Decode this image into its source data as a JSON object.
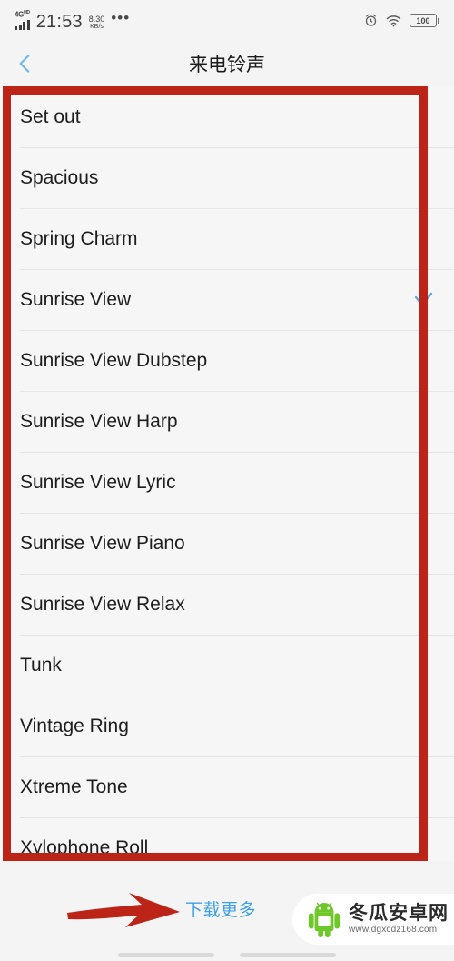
{
  "status_bar": {
    "network_type": "4G",
    "network_suffix": "HD",
    "time": "21:53",
    "net_speed_value": "8.30",
    "net_speed_unit": "KB/s",
    "overflow_dots": "•••",
    "alarm_icon": "alarm-clock-icon",
    "wifi_icon": "wifi-icon",
    "battery_level": "100"
  },
  "title_bar": {
    "back_icon": "chevron-left-icon",
    "title": "来电铃声"
  },
  "ringtone_list": {
    "selected": "Sunrise View",
    "check_icon": "checkmark-icon",
    "items": [
      {
        "label": "Set out",
        "selected": false
      },
      {
        "label": "Spacious",
        "selected": false
      },
      {
        "label": "Spring Charm",
        "selected": false
      },
      {
        "label": "Sunrise View",
        "selected": true
      },
      {
        "label": "Sunrise View Dubstep",
        "selected": false
      },
      {
        "label": "Sunrise View Harp",
        "selected": false
      },
      {
        "label": "Sunrise View Lyric",
        "selected": false
      },
      {
        "label": "Sunrise View Piano",
        "selected": false
      },
      {
        "label": "Sunrise View Relax",
        "selected": false
      },
      {
        "label": "Tunk",
        "selected": false
      },
      {
        "label": "Vintage Ring",
        "selected": false
      },
      {
        "label": "Xtreme Tone",
        "selected": false
      },
      {
        "label": "Xylophone Roll",
        "selected": false
      }
    ]
  },
  "bottom_bar": {
    "download_more_label": "下载更多"
  },
  "watermark": {
    "logo_icon": "android-mascot-icon",
    "site_name": "冬瓜安卓网",
    "site_url": "www.dgxcdz168.com"
  },
  "annotations": {
    "highlight_box_color": "#bc2418",
    "arrow_color": "#bc2418",
    "arrow_icon": "red-arrow-right-icon"
  },
  "colors": {
    "accent_blue": "#3da0e8",
    "background": "#f4f4f4",
    "list_background": "#f6f6f6",
    "text_primary": "#1d1d1d",
    "divider": "#e6e6e6"
  }
}
